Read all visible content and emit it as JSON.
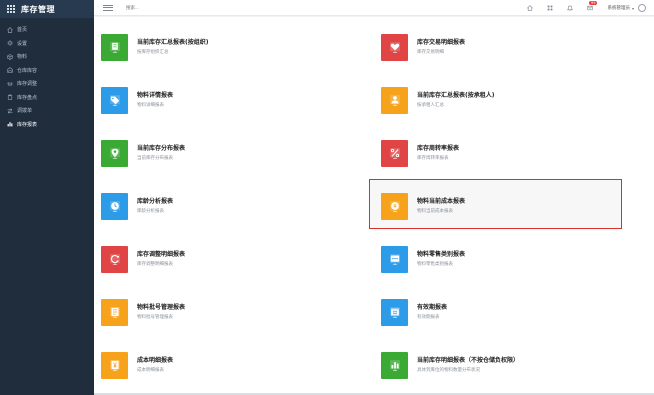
{
  "app": {
    "title": "库存管理"
  },
  "sidebar": {
    "items": [
      {
        "label": "首页",
        "icon": "home-icon"
      },
      {
        "label": "设置",
        "icon": "gear-icon"
      },
      {
        "label": "物料",
        "icon": "cube-icon"
      },
      {
        "label": "仓库库容",
        "icon": "warehouse-icon"
      },
      {
        "label": "库存调整",
        "icon": "adjust-icon"
      },
      {
        "label": "库存盘点",
        "icon": "clipboard-icon"
      },
      {
        "label": "调拨单",
        "icon": "transfer-icon"
      },
      {
        "label": "库存报表",
        "icon": "chart-icon",
        "active": true
      }
    ]
  },
  "topbar": {
    "search_placeholder": "搜索...",
    "notification_count": "99",
    "user_name": "系统管理员"
  },
  "reports": [
    {
      "title": "当前库存汇总报表(按组织)",
      "subtitle": "按库存组织汇总",
      "color": "#3aaa35",
      "icon": "building-icon"
    },
    {
      "title": "库存交易明细报表",
      "subtitle": "库存交易明细",
      "color": "#e04444",
      "icon": "heart-icon"
    },
    {
      "title": "物料详情报表",
      "subtitle": "物料详细报表",
      "color": "#2c9be8",
      "icon": "tag-icon"
    },
    {
      "title": "当前库存汇总报表(按承租人)",
      "subtitle": "按承租人汇总",
      "color": "#f7a21b",
      "icon": "person-icon"
    },
    {
      "title": "当前库存分布报表",
      "subtitle": "当前库存分布报表",
      "color": "#3aaa35",
      "icon": "location-icon"
    },
    {
      "title": "库存周转率报表",
      "subtitle": "库存周转率报表",
      "color": "#e04444",
      "icon": "percent-icon"
    },
    {
      "title": "库龄分析报表",
      "subtitle": "库龄分析报表",
      "color": "#2c9be8",
      "icon": "clock-icon"
    },
    {
      "title": "物料当前成本报表",
      "subtitle": "物料当前成本报表",
      "color": "#f7a21b",
      "icon": "coin-icon"
    },
    {
      "title": "库存调整明细报表",
      "subtitle": "库存调整明细报表",
      "color": "#e04444",
      "icon": "refresh-icon"
    },
    {
      "title": "物料零售类别报表",
      "subtitle": "物料零售类别报表",
      "color": "#2c9be8",
      "icon": "dots-icon"
    },
    {
      "title": "物料批号管理报表",
      "subtitle": "物料批号管理报表",
      "color": "#f7a21b",
      "icon": "list-icon"
    },
    {
      "title": "有效期报表",
      "subtitle": "有效期报表",
      "color": "#2c9be8",
      "icon": "calendar-icon"
    },
    {
      "title": "成本明细报表",
      "subtitle": "成本明细报表",
      "color": "#f7a21b",
      "icon": "yen-icon"
    },
    {
      "title": "当前库存明细报表（不按仓储负权限）",
      "subtitle": "具体到库位的物料数量分布状况",
      "color": "#3aaa35",
      "icon": "bars-icon"
    }
  ]
}
